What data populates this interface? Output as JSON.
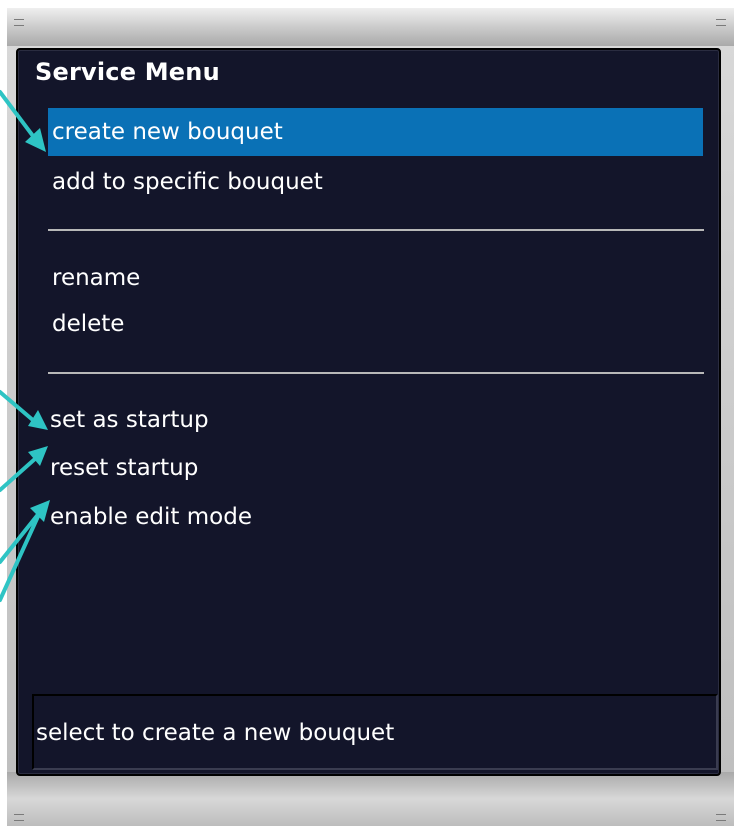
{
  "menu": {
    "title": "Service Menu",
    "groups": [
      {
        "items": [
          {
            "label": "create new bouquet",
            "selected": true
          },
          {
            "label": "add to specific bouquet",
            "selected": false
          }
        ]
      },
      {
        "items": [
          {
            "label": "rename",
            "selected": false
          },
          {
            "label": "delete",
            "selected": false
          }
        ]
      },
      {
        "items": [
          {
            "label": "set as startup",
            "selected": false
          },
          {
            "label": "reset startup",
            "selected": false
          },
          {
            "label": "enable edit mode",
            "selected": false
          }
        ]
      }
    ]
  },
  "status": {
    "help_text": "select to create a new bouquet"
  },
  "colors": {
    "background": "#13152a",
    "selection": "#0a71b6",
    "annotation_arrow": "#2ec4c4",
    "text": "#ffffff",
    "separator": "#b8b8b8"
  }
}
